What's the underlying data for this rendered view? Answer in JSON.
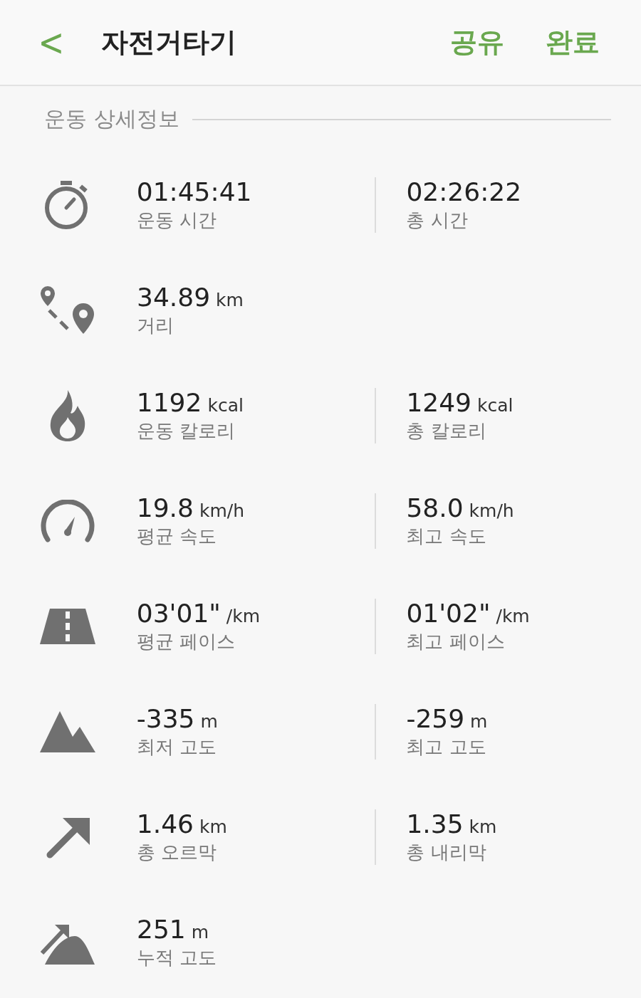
{
  "header": {
    "back": "<",
    "title": "자전거타기",
    "actions": [
      "공유",
      "완료"
    ]
  },
  "section_title": "운동 상세정보",
  "metrics": [
    {
      "kind": "stopwatch",
      "items": [
        {
          "value": "01:45:41",
          "label": "운동 시간"
        },
        {
          "value": "02:26:22",
          "label": "총 시간"
        }
      ]
    },
    {
      "kind": "route",
      "items": [
        {
          "value": "34.89",
          "unit": "km",
          "label": "거리"
        }
      ]
    },
    {
      "kind": "flame",
      "items": [
        {
          "value": "1192",
          "unit": "kcal",
          "label": "운동 칼로리"
        },
        {
          "value": "1249",
          "unit": "kcal",
          "label": "총 칼로리"
        }
      ]
    },
    {
      "kind": "speedometer",
      "items": [
        {
          "value": "19.8",
          "unit": "km/h",
          "label": "평균 속도"
        },
        {
          "value": "58.0",
          "unit": "km/h",
          "label": "최고 속도"
        }
      ]
    },
    {
      "kind": "road",
      "items": [
        {
          "value": "03'01\"",
          "unit": "/km",
          "label": "평균 페이스"
        },
        {
          "value": "01'02\"",
          "unit": "/km",
          "label": "최고 페이스"
        }
      ]
    },
    {
      "kind": "mountain",
      "items": [
        {
          "value": "-335",
          "unit": "m",
          "label": "최저 고도"
        },
        {
          "value": "-259",
          "unit": "m",
          "label": "최고 고도"
        }
      ]
    },
    {
      "kind": "arrow",
      "items": [
        {
          "value": "1.46",
          "unit": "km",
          "label": "총 오르막"
        },
        {
          "value": "1.35",
          "unit": "km",
          "label": "총 내리막"
        }
      ]
    },
    {
      "kind": "climb",
      "items": [
        {
          "value": "251",
          "unit": "m",
          "label": "누적 고도"
        }
      ]
    }
  ]
}
